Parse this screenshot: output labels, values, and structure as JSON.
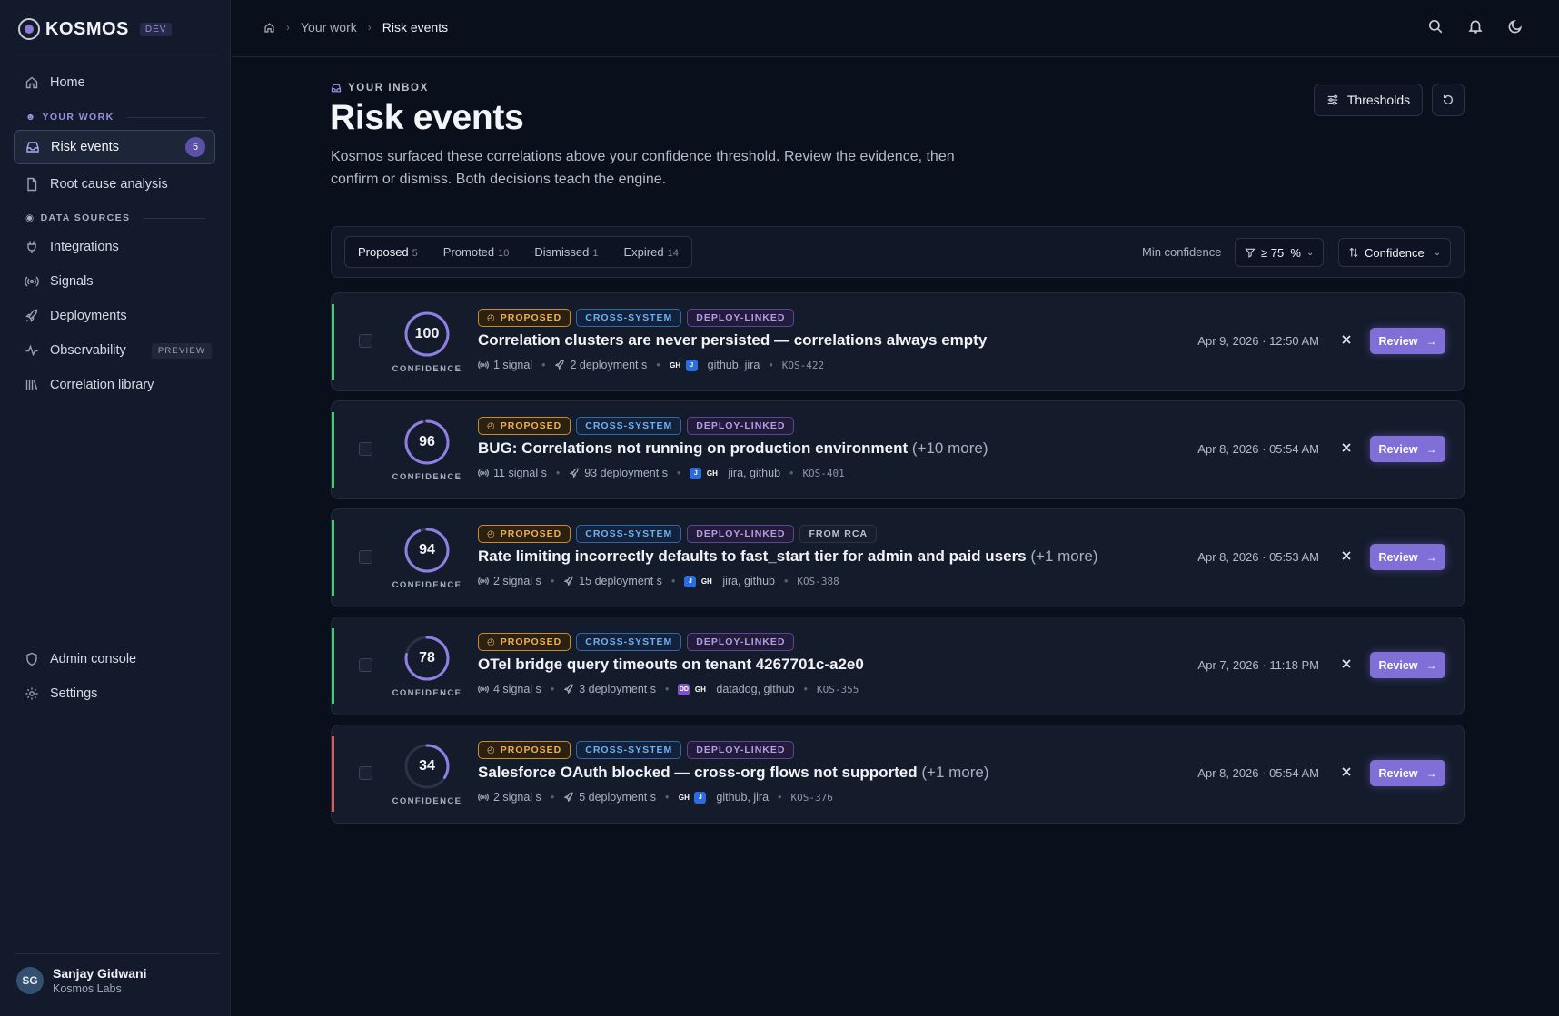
{
  "brand": {
    "name": "KOSMOS",
    "env": "DEV"
  },
  "sidebar": {
    "home": "Home",
    "your_work_label": "YOUR WORK",
    "risk_events": "Risk events",
    "risk_events_count": "5",
    "root_cause": "Root cause analysis",
    "data_sources_label": "DATA SOURCES",
    "integrations": "Integrations",
    "signals": "Signals",
    "deployments": "Deployments",
    "observability": "Observability",
    "observability_badge": "PREVIEW",
    "correlation_library": "Correlation library",
    "admin_console": "Admin console",
    "settings": "Settings"
  },
  "user": {
    "initials": "SG",
    "name": "Sanjay Gidwani",
    "org": "Kosmos Labs"
  },
  "breadcrumb": {
    "item1": "Your work",
    "item2": "Risk events"
  },
  "header": {
    "eyebrow": "YOUR INBOX",
    "title": "Risk events",
    "description": "Kosmos surfaced these correlations above your confidence threshold. Review the evidence, then confirm or dismiss. Both decisions teach the engine.",
    "thresholds_label": "Thresholds"
  },
  "filters": {
    "tabs": [
      {
        "label": "Proposed",
        "count": "5"
      },
      {
        "label": "Promoted",
        "count": "10"
      },
      {
        "label": "Dismissed",
        "count": "1"
      },
      {
        "label": "Expired",
        "count": "14"
      }
    ],
    "min_confidence_label": "Min confidence",
    "min_confidence_value": "≥ 75  %",
    "sort_label": "Confidence"
  },
  "labels": {
    "confidence": "CONFIDENCE",
    "review": "Review"
  },
  "colors": {
    "accent": "#7f6fd6",
    "green": "#3ecf6e",
    "red": "#e05a5a"
  },
  "events": [
    {
      "confidence": "100",
      "confidence_value": 100,
      "tags": [
        "PROPOSED",
        "CROSS-SYSTEM",
        "DEPLOY-LINKED"
      ],
      "title": "Correlation clusters are never persisted — correlations always empty",
      "more": "",
      "signals": "1 signal",
      "deployments": "2 deployment s",
      "sources": "github, jira",
      "source_icons": [
        "GH",
        "J"
      ],
      "key": "KOS-422",
      "date": "Apr 9, 2026 · 12:50 AM",
      "status_color": "green"
    },
    {
      "confidence": "96",
      "confidence_value": 96,
      "tags": [
        "PROPOSED",
        "CROSS-SYSTEM",
        "DEPLOY-LINKED"
      ],
      "title": "BUG: Correlations not running on production environment",
      "more": "(+10 more)",
      "signals": "11 signal s",
      "deployments": "93 deployment s",
      "sources": "jira, github",
      "source_icons": [
        "J",
        "GH"
      ],
      "key": "KOS-401",
      "date": "Apr 8, 2026 · 05:54 AM",
      "status_color": "green"
    },
    {
      "confidence": "94",
      "confidence_value": 94,
      "tags": [
        "PROPOSED",
        "CROSS-SYSTEM",
        "DEPLOY-LINKED",
        "FROM RCA"
      ],
      "title": "Rate limiting incorrectly defaults to fast_start tier for admin and paid users",
      "more": "(+1 more)",
      "signals": "2 signal s",
      "deployments": "15 deployment s",
      "sources": "jira, github",
      "source_icons": [
        "J",
        "GH"
      ],
      "key": "KOS-388",
      "date": "Apr 8, 2026 · 05:53 AM",
      "status_color": "green"
    },
    {
      "confidence": "78",
      "confidence_value": 78,
      "tags": [
        "PROPOSED",
        "CROSS-SYSTEM",
        "DEPLOY-LINKED"
      ],
      "title": "OTel bridge query timeouts on tenant 4267701c-a2e0",
      "more": "",
      "signals": "4 signal s",
      "deployments": "3 deployment s",
      "sources": "datadog, github",
      "source_icons": [
        "DD",
        "GH"
      ],
      "key": "KOS-355",
      "date": "Apr 7, 2026 · 11:18 PM",
      "status_color": "green"
    },
    {
      "confidence": "34",
      "confidence_value": 34,
      "tags": [
        "PROPOSED",
        "CROSS-SYSTEM",
        "DEPLOY-LINKED"
      ],
      "title": "Salesforce OAuth blocked — cross-org flows not supported",
      "more": "(+1 more)",
      "signals": "2 signal s",
      "deployments": "5 deployment s",
      "sources": "github, jira",
      "source_icons": [
        "GH",
        "J"
      ],
      "key": "KOS-376",
      "date": "Apr 8, 2026 · 05:54 AM",
      "status_color": "red"
    }
  ]
}
